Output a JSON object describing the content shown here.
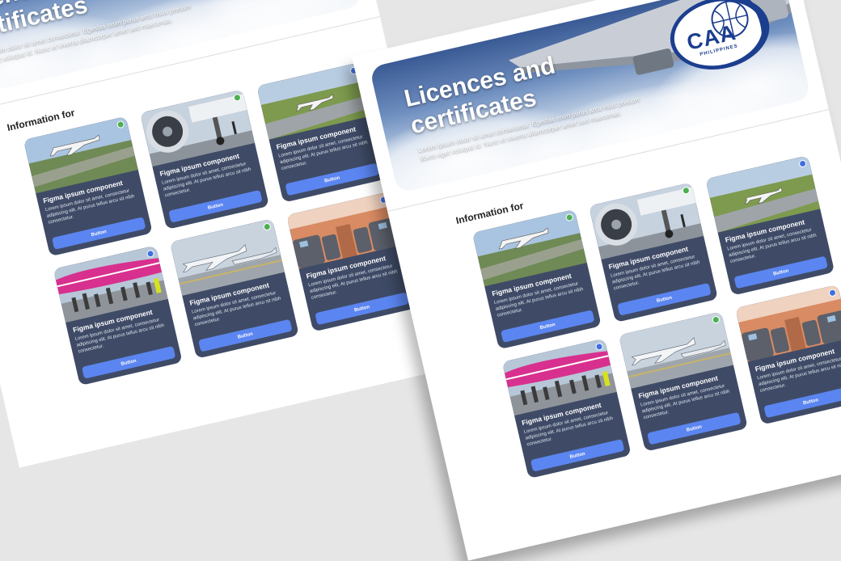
{
  "hero": {
    "title": "Licences and certificates",
    "subtitle": "Lorem ipsum dolor sit amet consectetur. Egestas enim purus arcu risus pretium libero eget volutpat id. Nunc et viverra ullamcorper amet sed maecenas."
  },
  "logo": {
    "text": "CAA",
    "sub": "PHILIPPINES"
  },
  "section": {
    "title": "Information for"
  },
  "cards": [
    {
      "title": "Figma ipsum component",
      "desc": "Lorem ipsum dolor sit amet, consectetur adipiscing elit. At purus tellus arcu sit nibh consectetur.",
      "button": "Button",
      "status_color": "#4caf50",
      "scene": "airport-field"
    },
    {
      "title": "Figma ipsum component",
      "desc": "Lorem ipsum dolor sit amet, consectetur adipiscing elit. At purus tellus arcu sit nibh consectetur.",
      "button": "Button",
      "status_color": "#4caf50",
      "scene": "jet-engine"
    },
    {
      "title": "Figma ipsum component",
      "desc": "Lorem ipsum dolor sit amet, consectetur adipiscing elit. At purus tellus arcu sit nibh consectetur.",
      "button": "Button",
      "status_color": "#3f6fe0",
      "scene": "runway"
    },
    {
      "title": "Figma ipsum component",
      "desc": "Lorem ipsum dolor sit amet, consectetur adipiscing elit. At purus tellus arcu sit nibh consectetur.",
      "button": "Button",
      "status_color": "#3f6fe0",
      "scene": "passengers"
    },
    {
      "title": "Figma ipsum component",
      "desc": "Lorem ipsum dolor sit amet, consectetur adipiscing elit. At purus tellus arcu sit nibh consectetur.",
      "button": "Button",
      "status_color": "#4caf50",
      "scene": "hangar"
    },
    {
      "title": "Figma ipsum component",
      "desc": "Lorem ipsum dolor sit amet, consectetur adipiscing elit. At purus tellus arcu sit nibh consectetur.",
      "button": "Button",
      "status_color": "#3f6fe0",
      "scene": "cabin"
    }
  ],
  "colors": {
    "background": "#e6e6e6",
    "card": "#3f4b66",
    "button": "#5b85f0",
    "logo_blue": "#1c3e8f"
  }
}
